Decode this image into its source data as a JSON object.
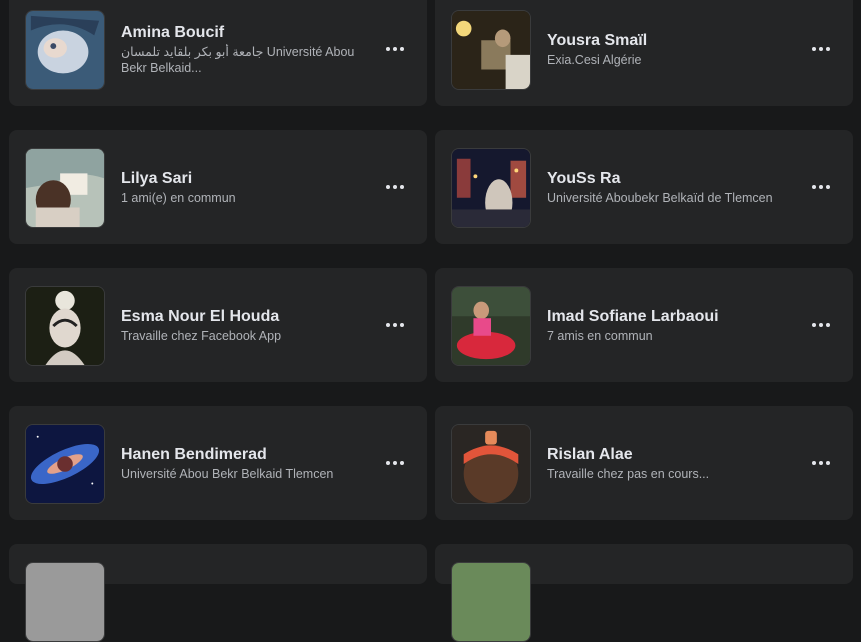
{
  "friends": [
    {
      "name": "Amina Boucif",
      "subtitle": "جامعة أبو بكر بلقايد تلمسان Université Abou Bekr Belkaid..."
    },
    {
      "name": "Yousra Smaïl",
      "subtitle": "Exia.Cesi Algérie"
    },
    {
      "name": "Lilya Sari",
      "subtitle": "1 ami(e) en commun"
    },
    {
      "name": "YouSs Ra",
      "subtitle": "Université Aboubekr Belkaïd de Tlemcen"
    },
    {
      "name": "Esma Nour El Houda",
      "subtitle": "Travaille chez Facebook App"
    },
    {
      "name": "Imad Sofiane Larbaoui",
      "subtitle": "7 amis en commun"
    },
    {
      "name": "Hanen Bendimerad",
      "subtitle": "Université Abou Bekr Belkaid Tlemcen"
    },
    {
      "name": "Rislan Alae",
      "subtitle": "Travaille chez pas en cours..."
    }
  ],
  "more_icon": "more-horizontal-icon"
}
